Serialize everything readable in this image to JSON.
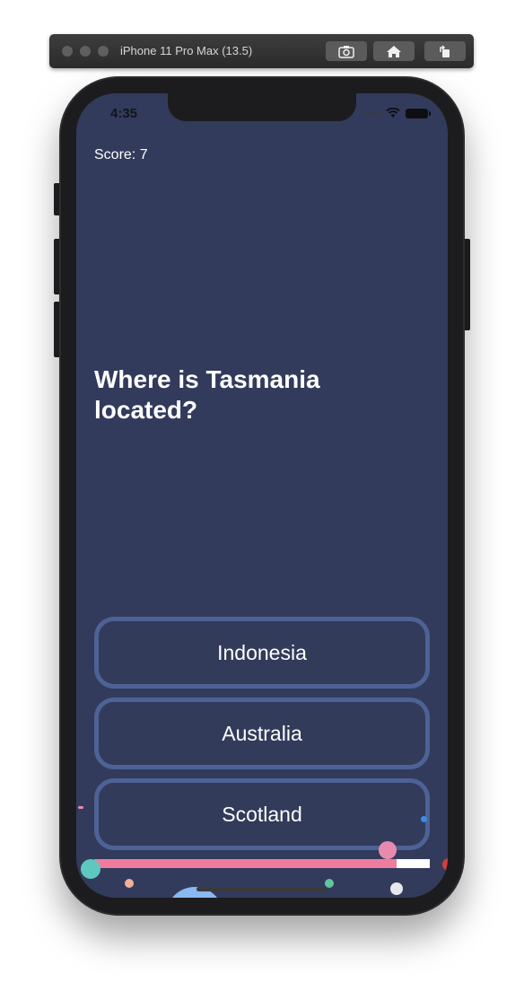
{
  "simulator": {
    "title": "iPhone 11 Pro Max (13.5)",
    "buttons": [
      {
        "name": "screenshot-icon"
      },
      {
        "name": "home-icon"
      },
      {
        "name": "rotate-icon"
      }
    ]
  },
  "status_bar": {
    "time": "4:35",
    "icons": [
      "cellular-signal-icon",
      "wifi-icon",
      "battery-icon"
    ]
  },
  "game": {
    "score_label": "Score: 7",
    "question": "Where is Tasmania located?",
    "answers": [
      "Indonesia",
      "Australia",
      "Scotland"
    ],
    "timer_progress": 0.9
  },
  "colors": {
    "background": "#323b5b",
    "answer_border": "#4d6296",
    "progress_fill": "#ee7c9e",
    "progress_track": "#ffffff"
  }
}
